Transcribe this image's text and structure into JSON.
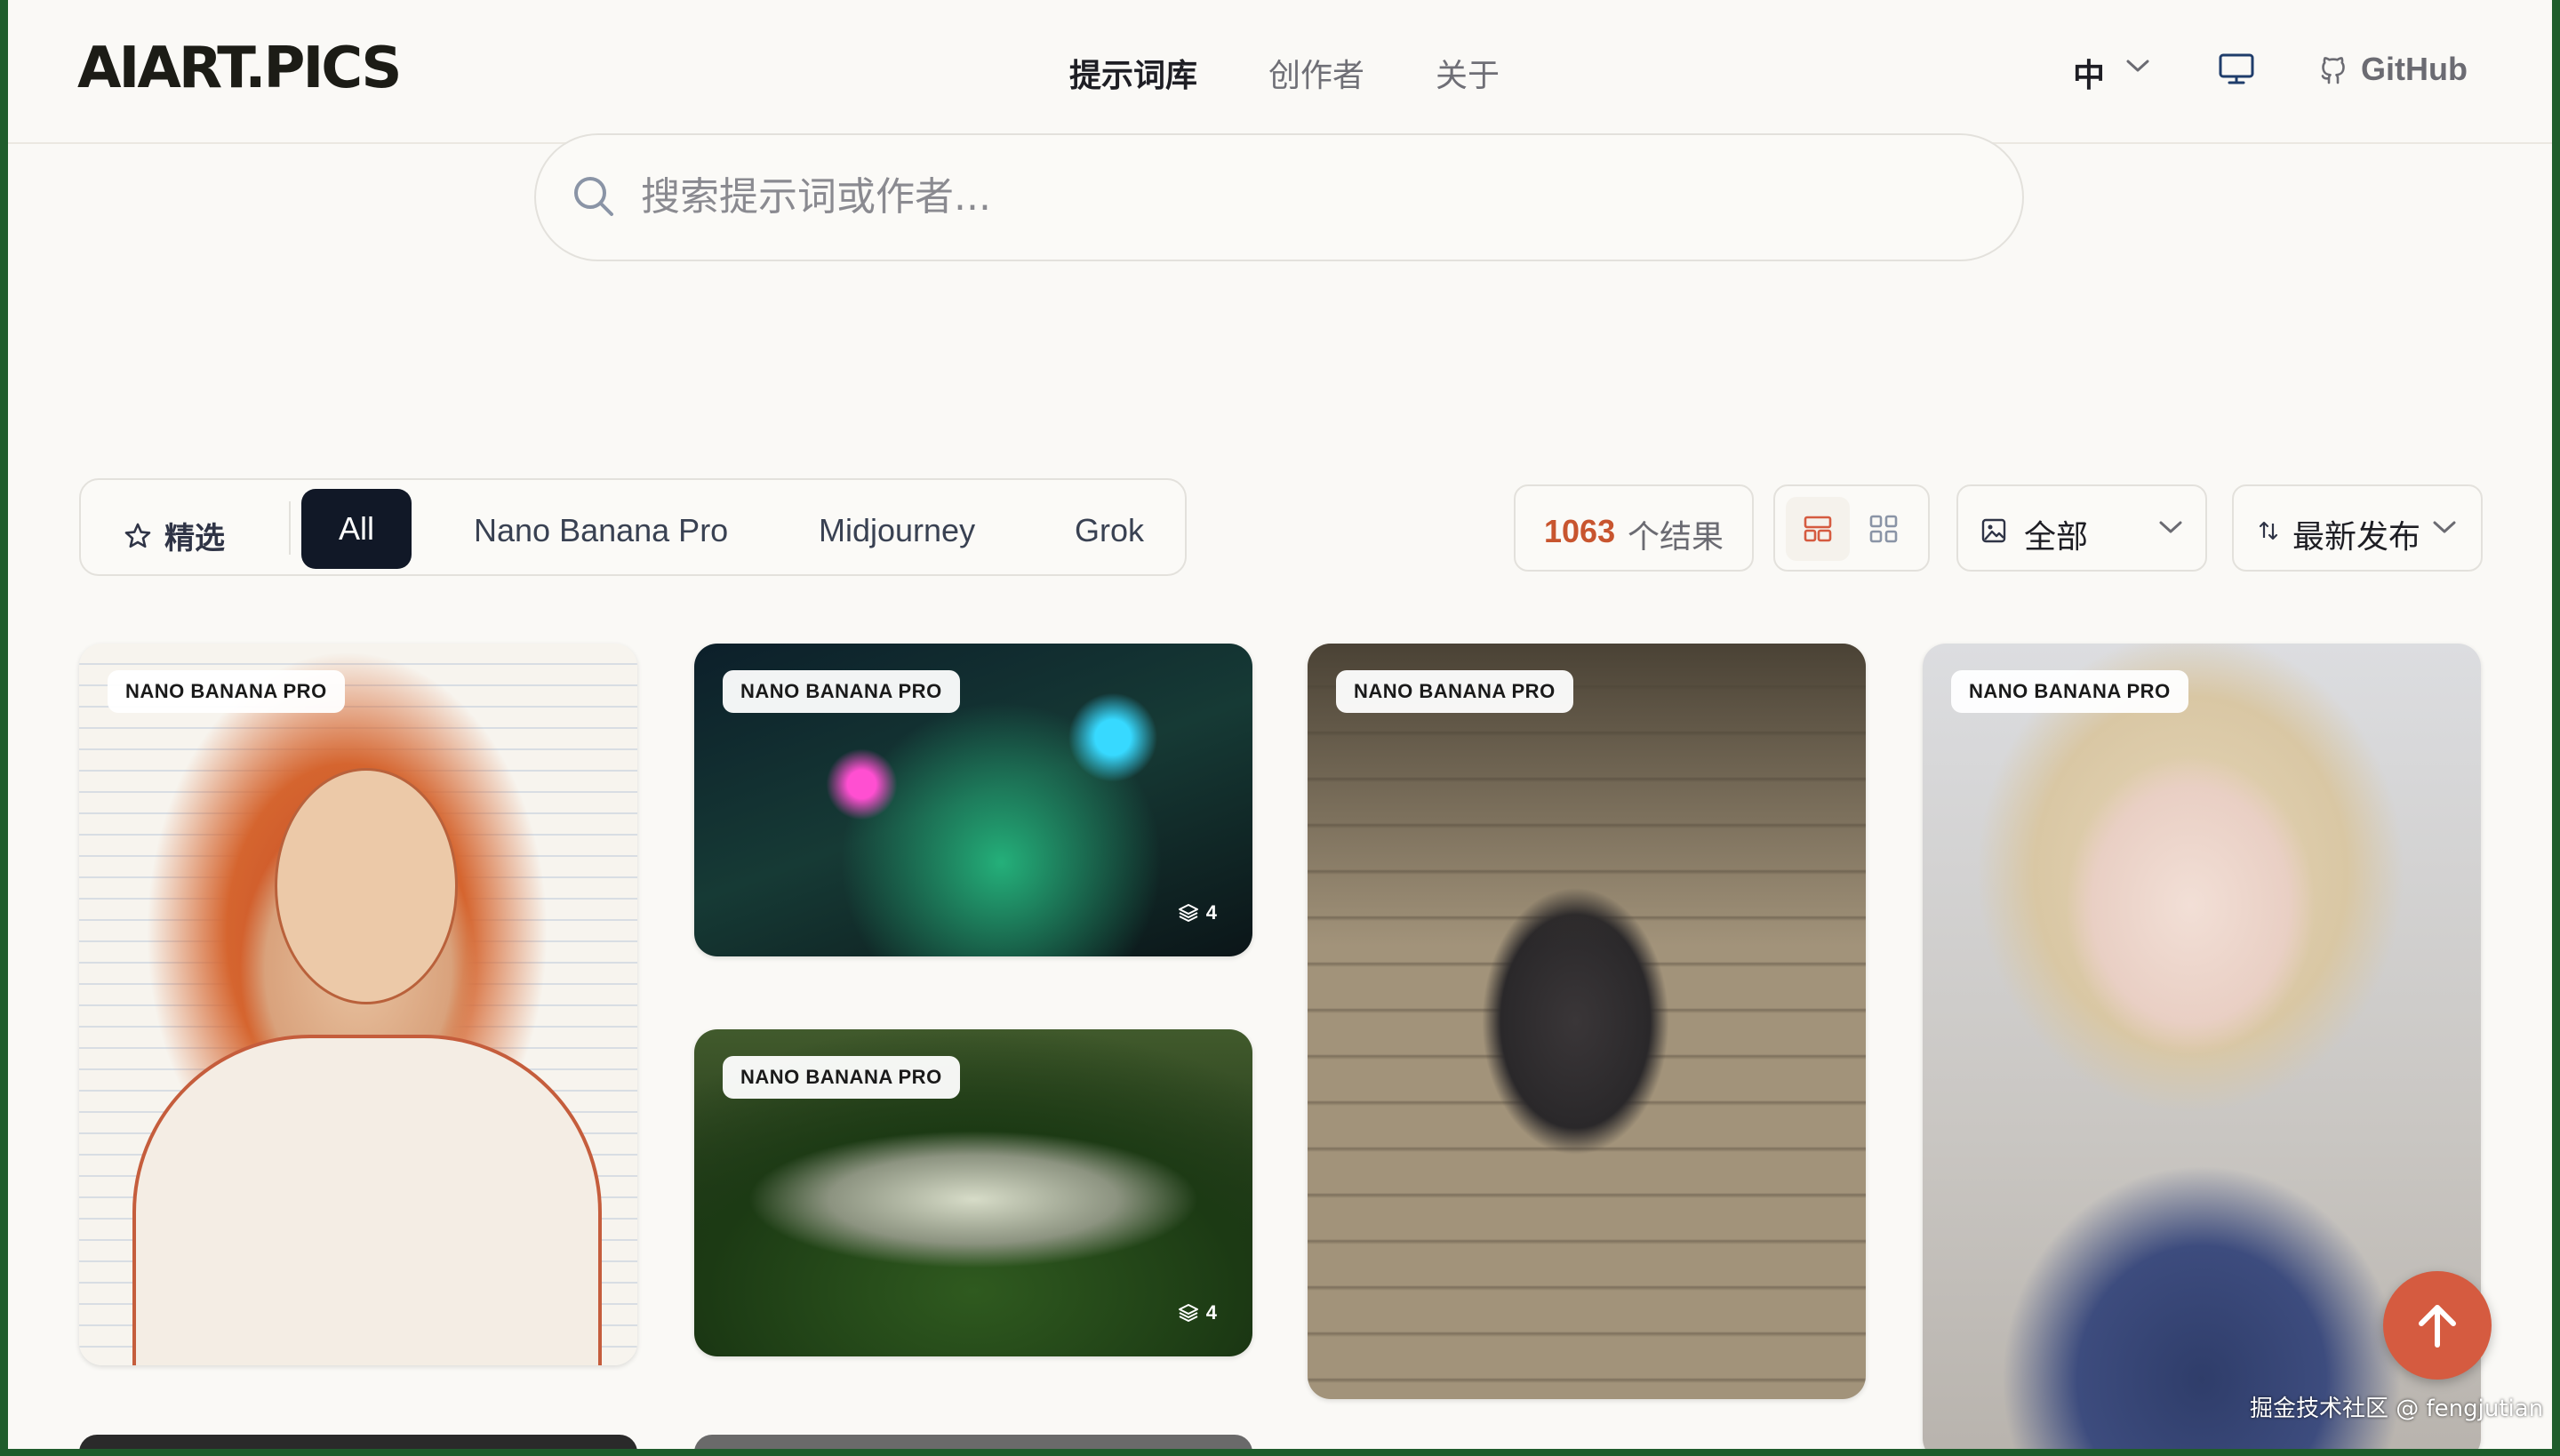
{
  "header": {
    "logo": "AIART.PICS",
    "nav": [
      {
        "label": "提示词库",
        "active": true
      },
      {
        "label": "创作者",
        "active": false
      },
      {
        "label": "关于",
        "active": false
      }
    ],
    "language": "中",
    "github_label": "GitHub"
  },
  "search": {
    "placeholder": "搜索提示词或作者..."
  },
  "filters": {
    "featured_label": "精选",
    "tabs": [
      "All",
      "Nano Banana Pro",
      "Midjourney",
      "Grok"
    ],
    "active_tab": "All"
  },
  "results": {
    "count": "1063",
    "unit": "个结果"
  },
  "category_select": {
    "value": "全部"
  },
  "sort_select": {
    "value": "最新发布"
  },
  "cards": [
    {
      "badge": "NANO BANANA PRO",
      "subject": "sketch portrait"
    },
    {
      "badge": "NANO BANANA PRO",
      "subject": "neon jungle city",
      "image_count": "4"
    },
    {
      "badge": "NANO BANANA PRO",
      "subject": "plane in jungle",
      "image_count": "4"
    },
    {
      "badge": "NANO BANANA PRO",
      "subject": "stone stairs portrait"
    },
    {
      "badge": "NANO BANANA PRO",
      "subject": "blonde portrait"
    }
  ],
  "watermark": "掘金技术社区 @ fengjutian",
  "colors": {
    "accent": "#d55b40",
    "count_highlight": "#c8552f",
    "active_tab_bg": "#111827",
    "page_bg": "#faf9f6"
  },
  "icons": [
    "search-icon",
    "star-icon",
    "chevron-down-icon",
    "monitor-icon",
    "github-icon",
    "layout-masonry-icon",
    "layout-grid-icon",
    "image-icon",
    "sort-icon",
    "layers-icon",
    "arrow-up-icon"
  ]
}
